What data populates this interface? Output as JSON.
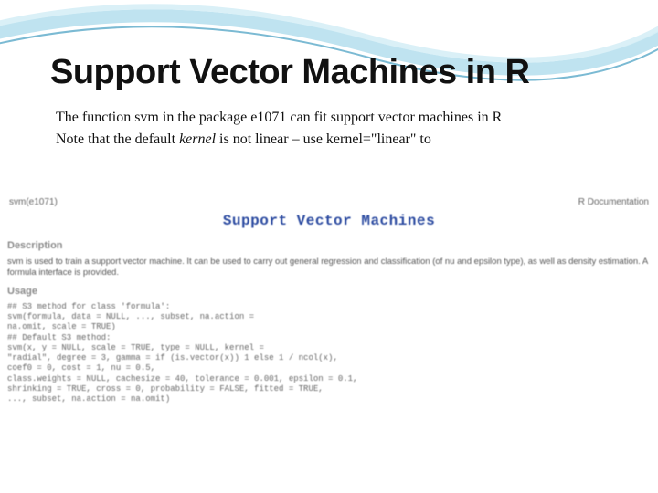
{
  "slide": {
    "title": "Support Vector Machines in R",
    "para1_a": "The function svm in the package e",
    "para1_b": "1071",
    "para1_c": " can fit support vector machines in R",
    "para2_a": " Note that the default ",
    "para2_b": "kernel",
    "para2_c": " is not linear – use kernel=\"linear\" to"
  },
  "rdoc": {
    "pkg": "svm(e1071)",
    "source": "R Documentation",
    "title": "Support Vector Machines",
    "section_desc": "Description",
    "desc_text": "svm is used to train a support vector machine. It can be used to carry out general regression and classification (of nu and epsilon type), as well as density estimation. A formula interface is provided.",
    "section_usage": "Usage",
    "code": "## S3 method for class 'formula':\nsvm(formula, data = NULL, ..., subset, na.action =\nna.omit, scale = TRUE)\n## Default S3 method:\nsvm(x, y = NULL, scale = TRUE, type = NULL, kernel =\n\"radial\", degree = 3, gamma = if (is.vector(x)) 1 else 1 / ncol(x),\ncoef0 = 0, cost = 1, nu = 0.5,\nclass.weights = NULL, cachesize = 40, tolerance = 0.001, epsilon = 0.1,\nshrinking = TRUE, cross = 0, probability = FALSE, fitted = TRUE,\n..., subset, na.action = na.omit)"
  }
}
